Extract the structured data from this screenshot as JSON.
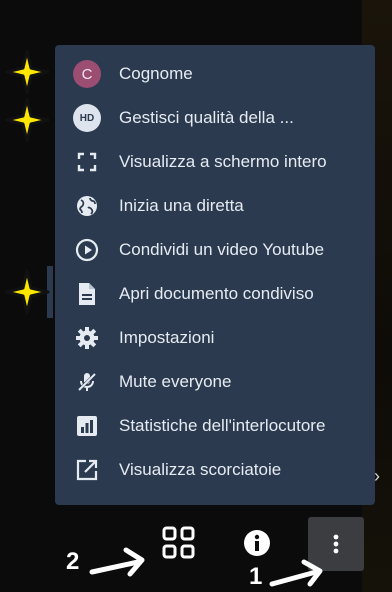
{
  "menu": {
    "items": [
      {
        "label": "Cognome",
        "icon": "avatar-letter-icon",
        "avatar_text": "C"
      },
      {
        "label": "Gestisci qualità della ...",
        "icon": "hd-quality-icon",
        "avatar_text": "HD"
      },
      {
        "label": "Visualizza a schermo intero",
        "icon": "fullscreen-icon"
      },
      {
        "label": "Inizia una diretta",
        "icon": "globe-icon"
      },
      {
        "label": "Condividi un video Youtube",
        "icon": "play-circle-icon"
      },
      {
        "label": "Apri documento condiviso",
        "icon": "document-icon"
      },
      {
        "label": "Impostazioni",
        "icon": "gear-icon"
      },
      {
        "label": "Mute everyone",
        "icon": "mic-off-icon"
      },
      {
        "label": "Statistiche dell'interlocutore",
        "icon": "stats-icon"
      },
      {
        "label": "Visualizza scorciatoie",
        "icon": "external-link-icon"
      }
    ]
  },
  "toolbar": {
    "tile_view_icon": "tile-grid-icon",
    "info_icon": "info-icon",
    "more_icon": "more-vertical-icon"
  },
  "annotations": {
    "label_1": "1",
    "label_2": "2"
  },
  "colors": {
    "menu_bg": "#2b3a4f",
    "text": "#e6ebf2",
    "avatar_c": "#9b4d72",
    "star": "#ffe600",
    "more_btn_bg": "#3b3d41"
  }
}
